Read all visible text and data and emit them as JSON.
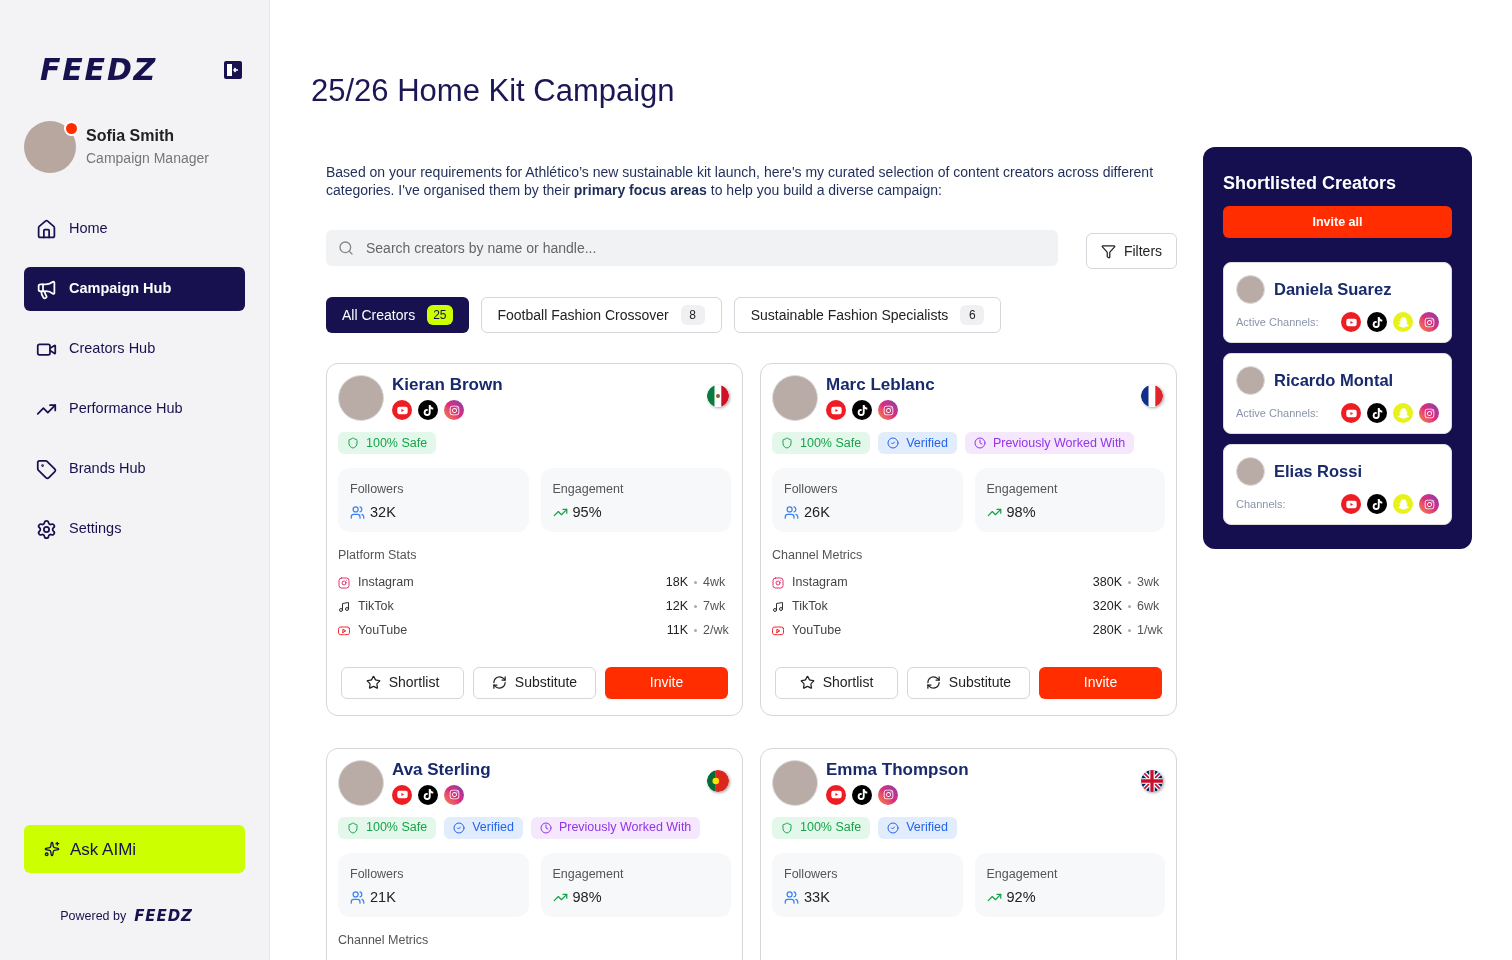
{
  "sidebar": {
    "logo": "FEEDZ",
    "user": {
      "name": "Sofia Smith",
      "role": "Campaign Manager",
      "notification": true
    },
    "items": [
      {
        "kind": "home",
        "label": "Home",
        "selected": false
      },
      {
        "kind": "campaign",
        "label": "Campaign Hub",
        "selected": true
      },
      {
        "kind": "creators",
        "label": "Creators Hub",
        "selected": false
      },
      {
        "kind": "performance",
        "label": "Performance Hub",
        "selected": false
      },
      {
        "kind": "brands",
        "label": "Brands Hub",
        "selected": false
      },
      {
        "kind": "settings",
        "label": "Settings",
        "selected": false
      }
    ],
    "ask_button": "Ask AIMi",
    "powered_by": "Powered by",
    "powered_logo": "FEEDZ"
  },
  "page": {
    "title": "25/26 Home Kit Campaign",
    "intro": "Based on your requirements for Athlético’s new sustainable kit launch, here's my curated selection of content creators across different categories. I've organised them by their **primary focus areas** to help you build a diverse campaign:",
    "search": {
      "placeholder": "Search creators by name or handle..."
    },
    "filters_button": "Filters",
    "tabs": [
      {
        "label": "All Creators",
        "count": "25",
        "selected": true
      },
      {
        "label": "Football Fashion Crossover",
        "count": "8",
        "selected": false
      },
      {
        "label": "Sustainable Fashion Specialists",
        "count": "6",
        "selected": false
      }
    ],
    "creators": [
      {
        "name": "Kieran Brown",
        "flag": {
          "kind": "mx"
        },
        "channels": [
          {
            "kind": "youtube"
          },
          {
            "kind": "tiktok"
          },
          {
            "kind": "instagram"
          }
        ],
        "badges": [
          {
            "kind": "safe",
            "label": "100% Safe"
          }
        ],
        "followers_label": "Followers",
        "followers": "32K",
        "engagement_label": "Engagement",
        "engagement": "95%",
        "stats_title": "Platform Stats",
        "platforms": [
          {
            "kind": "instagram",
            "name": "Instagram",
            "value": "18K",
            "rate": "4wk"
          },
          {
            "kind": "tiktok",
            "name": "TikTok",
            "value": "12K",
            "rate": "7wk"
          },
          {
            "kind": "youtube",
            "name": "YouTube",
            "value": "11K",
            "rate": "2/wk"
          }
        ],
        "actions": [
          {
            "kind": "shortlist",
            "label": "Shortlist"
          },
          {
            "kind": "substitute",
            "label": "Substitute"
          },
          {
            "kind": "invite",
            "label": "Invite"
          }
        ]
      },
      {
        "name": "Marc Leblanc",
        "flag": {
          "kind": "fr"
        },
        "channels": [
          {
            "kind": "youtube"
          },
          {
            "kind": "tiktok"
          },
          {
            "kind": "instagram"
          }
        ],
        "badges": [
          {
            "kind": "safe",
            "label": "100% Safe"
          },
          {
            "kind": "verified",
            "label": "Verified"
          },
          {
            "kind": "previous",
            "label": "Previously Worked With"
          }
        ],
        "followers_label": "Followers",
        "followers": "26K",
        "engagement_label": "Engagement",
        "engagement": "98%",
        "stats_title": "Channel Metrics",
        "platforms": [
          {
            "kind": "instagram",
            "name": "Instagram",
            "value": "380K",
            "rate": "3wk"
          },
          {
            "kind": "tiktok",
            "name": "TikTok",
            "value": "320K",
            "rate": "6wk"
          },
          {
            "kind": "youtube",
            "name": "YouTube",
            "value": "280K",
            "rate": "1/wk"
          }
        ],
        "actions": [
          {
            "kind": "shortlist",
            "label": "Shortlist"
          },
          {
            "kind": "substitute",
            "label": "Substitute"
          },
          {
            "kind": "invite",
            "label": "Invite"
          }
        ]
      },
      {
        "name": "Ava Sterling",
        "flag": {
          "kind": "pt"
        },
        "channels": [
          {
            "kind": "youtube"
          },
          {
            "kind": "tiktok"
          },
          {
            "kind": "instagram"
          }
        ],
        "badges": [
          {
            "kind": "safe",
            "label": "100% Safe"
          },
          {
            "kind": "verified",
            "label": "Verified"
          },
          {
            "kind": "previous",
            "label": "Previously Worked With"
          }
        ],
        "followers_label": "Followers",
        "followers": "21K",
        "engagement_label": "Engagement",
        "engagement": "98%",
        "stats_title": "Channel Metrics"
      },
      {
        "name": "Emma Thompson",
        "flag": {
          "kind": "gb"
        },
        "channels": [
          {
            "kind": "youtube"
          },
          {
            "kind": "tiktok"
          },
          {
            "kind": "instagram"
          }
        ],
        "badges": [
          {
            "kind": "safe",
            "label": "100% Safe"
          },
          {
            "kind": "verified",
            "label": "Verified"
          }
        ],
        "followers_label": "Followers",
        "followers": "33K",
        "engagement_label": "Engagement",
        "engagement": "92%"
      }
    ]
  },
  "shortlist": {
    "title": "Shortlisted Creators",
    "invite_all": "Invite all",
    "items": [
      {
        "name": "Daniela Suarez",
        "channels_label": "Active Channels:",
        "channels": [
          {
            "kind": "youtube"
          },
          {
            "kind": "tiktok"
          },
          {
            "kind": "snapchat"
          },
          {
            "kind": "instagram"
          }
        ]
      },
      {
        "name": "Ricardo Montal",
        "channels_label": "Active Channels:",
        "channels": [
          {
            "kind": "youtube"
          },
          {
            "kind": "tiktok"
          },
          {
            "kind": "snapchat"
          },
          {
            "kind": "instagram"
          }
        ]
      },
      {
        "name": "Elias Rossi",
        "channels_label": "Channels:",
        "channels": [
          {
            "kind": "youtube"
          },
          {
            "kind": "tiktok"
          },
          {
            "kind": "snapchat"
          },
          {
            "kind": "instagram"
          }
        ]
      }
    ]
  }
}
